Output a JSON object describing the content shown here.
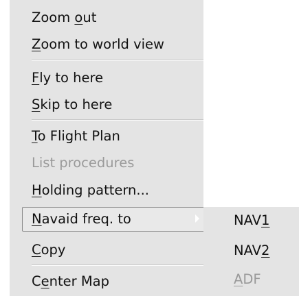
{
  "menu": {
    "items": [
      {
        "pre": "Zoom ",
        "key": "o",
        "post": "ut",
        "enabled": true
      },
      {
        "pre": "",
        "key": "Z",
        "post": "oom to world view",
        "enabled": true
      },
      {
        "pre": "",
        "key": "F",
        "post": "ly to here",
        "enabled": true
      },
      {
        "pre": "",
        "key": "S",
        "post": "kip to here",
        "enabled": true
      },
      {
        "pre": "",
        "key": "T",
        "post": "o Flight Plan",
        "enabled": true
      },
      {
        "pre": "",
        "key": "",
        "post": "List procedures",
        "enabled": false
      },
      {
        "pre": "",
        "key": "H",
        "post": "olding pattern...",
        "enabled": true
      },
      {
        "pre": "",
        "key": "N",
        "post": "avaid freq. to",
        "enabled": true,
        "highlighted": true,
        "has_submenu": true
      },
      {
        "pre": "",
        "key": "C",
        "post": "opy",
        "enabled": true
      },
      {
        "pre": "C",
        "key": "e",
        "post": "nter Map",
        "enabled": true
      }
    ]
  },
  "submenu": {
    "items": [
      {
        "pre": "NAV",
        "key": "1",
        "post": "",
        "enabled": true
      },
      {
        "pre": "NAV",
        "key": "2",
        "post": "",
        "enabled": true
      },
      {
        "pre": "",
        "key": "A",
        "post": "DF",
        "enabled": false
      }
    ]
  },
  "colors": {
    "menu_background": "#e4e4e4",
    "text": "#111111",
    "disabled_text": "#9a9a9a",
    "highlight_border": "#888888"
  }
}
